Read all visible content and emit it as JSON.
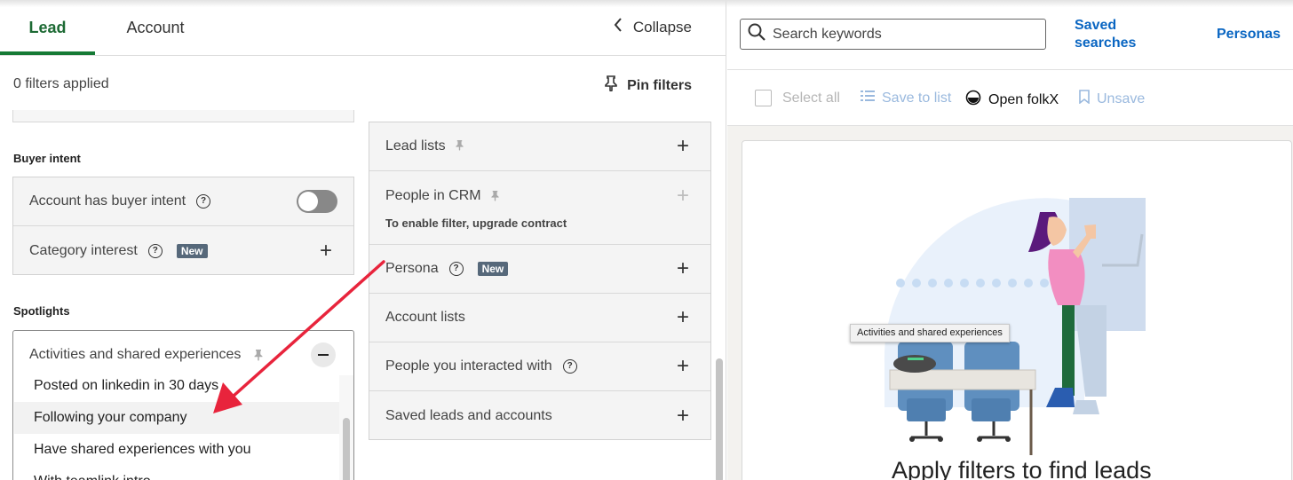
{
  "tabs": {
    "lead": "Lead",
    "account": "Account"
  },
  "collapse_label": "Collapse",
  "filters_applied": "0 filters applied",
  "pin_filters_label": "Pin filters",
  "buyer_intent": {
    "title": "Buyer intent",
    "rows": [
      {
        "label": "Account has buyer intent"
      },
      {
        "label": "Category interest",
        "badge": "New"
      }
    ]
  },
  "spotlights": {
    "title": "Spotlights",
    "expanded_label": "Activities and shared experiences",
    "options": [
      "Posted on linkedin in 30 days",
      "Following your company",
      "Have shared experiences with you",
      "With teamlink intro"
    ]
  },
  "middle_filters": [
    {
      "label": "Lead lists"
    },
    {
      "label": "People in CRM",
      "note": "To enable filter, upgrade contract"
    },
    {
      "label": "Persona",
      "badge": "New"
    },
    {
      "label": "Account lists"
    },
    {
      "label": "People you interacted with"
    },
    {
      "label": "Saved leads and accounts"
    }
  ],
  "search": {
    "placeholder": "Search keywords"
  },
  "saved_searches": [
    "Saved",
    "searches"
  ],
  "personas_link": "Personas",
  "toolbar": {
    "select_all": "Select all",
    "save_to_list": "Save to list",
    "open_folkx": "Open folkX",
    "unsave": "Unsave"
  },
  "tooltip": "Activities and shared experiences",
  "empty_state_title": "Apply filters to find leads",
  "colors": {
    "accent_green": "#157a35",
    "link_blue": "#0a66c2",
    "arrow_red": "#e8243c"
  }
}
